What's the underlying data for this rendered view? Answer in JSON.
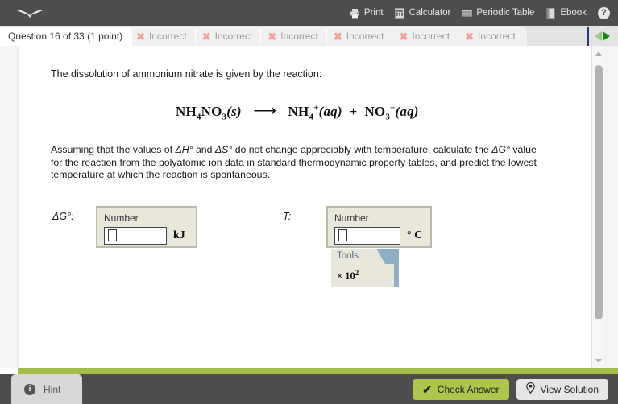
{
  "topbar": {
    "logo_icon": "wings-logo-icon",
    "tools": [
      {
        "icon": "printer-icon",
        "label": "Print"
      },
      {
        "icon": "calculator-icon",
        "label": "Calculator"
      },
      {
        "icon": "periodic-table-icon",
        "label": "Periodic Table"
      },
      {
        "icon": "ebook-icon",
        "label": "Ebook"
      }
    ],
    "help": {
      "icon": "help-question-icon",
      "glyph": "?"
    }
  },
  "tabs": {
    "active": "Question 16 of 33 (1 point)",
    "incorrect": [
      {
        "status_icon": "x-mark-icon",
        "glyph": "✖",
        "label": "Incorrect"
      },
      {
        "status_icon": "x-mark-icon",
        "glyph": "✖",
        "label": "Incorrect"
      },
      {
        "status_icon": "x-mark-icon",
        "glyph": "✖",
        "label": "Incorrect"
      },
      {
        "status_icon": "x-mark-icon",
        "glyph": "✖",
        "label": "Incorrect"
      },
      {
        "status_icon": "x-mark-icon",
        "glyph": "✖",
        "label": "Incorrect"
      },
      {
        "status_icon": "x-mark-icon",
        "glyph": "✖",
        "label": "Incorrect"
      }
    ],
    "nav_icon": "prev-next-arrows-icon"
  },
  "question": {
    "intro": "The dissolution of ammonium nitrate is given by the reaction:",
    "equation": {
      "reactant": "NH4NO3(s)",
      "arrow": "⟶",
      "product_1": "NH4+(aq)",
      "plus": "+",
      "product_2": "NO3−(aq)"
    },
    "body": "Assuming that the values of ΔH° and ΔS° do not change appreciably with temperature, calculate the ΔG° value for the reaction from the polyatomic ion data in standard thermodynamic property tables, and predict the lowest temperature at which the reaction is spontaneous."
  },
  "answers": {
    "gibbs": {
      "label": "ΔG°:",
      "box_label": "Number",
      "value": "",
      "unit": "kJ"
    },
    "temperature": {
      "label": "T:",
      "box_label": "Number",
      "value": "",
      "unit": "° C"
    },
    "tools_panel": {
      "title": "Tools",
      "option": "× 10",
      "option_exponent": "2"
    }
  },
  "footer": {
    "hint": {
      "icon": "info-icon",
      "glyph": "i",
      "label": "Hint"
    },
    "check_answer": {
      "icon": "checkmark-icon",
      "glyph": "✔",
      "label": "Check Answer"
    },
    "view_solution": {
      "icon": "lightbulb-pin-icon",
      "label": "View Solution"
    }
  },
  "colors": {
    "topbar": "#4d4d4d",
    "accent_green": "#a2bd4a",
    "check_button": "#aec64c",
    "incorrect_x": "#f2a0a0",
    "input_panel": "#e9e7dc",
    "tools_panel": "#8fafc4"
  }
}
